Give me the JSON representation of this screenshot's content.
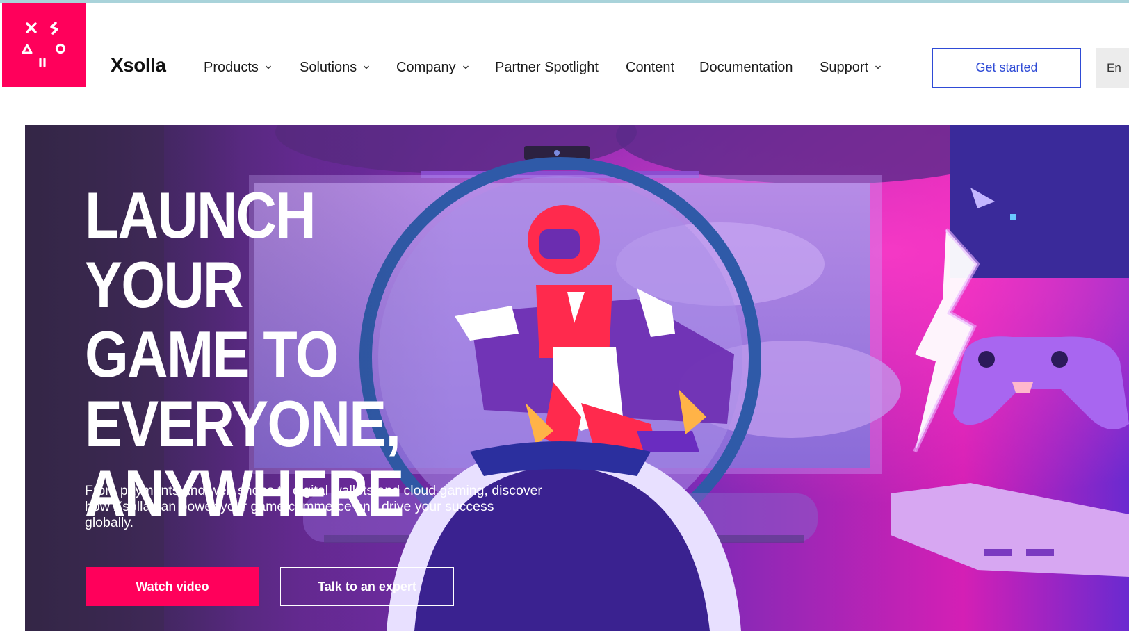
{
  "header": {
    "brand": "Xsolla",
    "nav": [
      {
        "label": "Products",
        "dropdown": true
      },
      {
        "label": "Solutions",
        "dropdown": true
      },
      {
        "label": "Company",
        "dropdown": true
      },
      {
        "label": "Partner Spotlight",
        "dropdown": false
      },
      {
        "label": "Content",
        "dropdown": false
      },
      {
        "label": "Documentation",
        "dropdown": false
      },
      {
        "label": "Support",
        "dropdown": true
      }
    ],
    "get_started_label": "Get started",
    "language_label": "En"
  },
  "hero": {
    "title_lines": [
      "LAUNCH YOUR",
      "GAME TO",
      "EVERYONE,",
      "ANYWHERE"
    ],
    "description": "From payments and web shops to digital wallets and cloud gaming, discover how Xsolla can power your game commerce and drive your success globally.",
    "watch_video_label": "Watch video",
    "talk_expert_label": "Talk to an expert"
  },
  "colors": {
    "brand_pink": "#ff005b",
    "accent_blue": "#2f4bd6",
    "hero_purple": "#5a1e8f"
  },
  "icons": {
    "logo": "xsolla-logo-symbols",
    "dropdown": "chevron-down-icon"
  }
}
